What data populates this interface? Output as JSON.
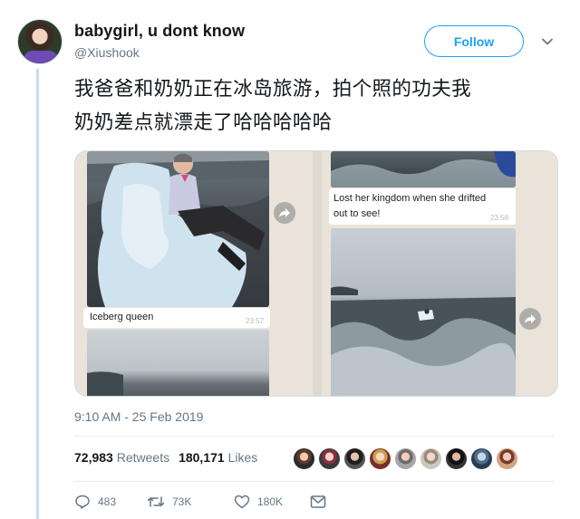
{
  "author": {
    "display_name": "babygirl, u dont know",
    "handle": "@Xiushook"
  },
  "follow_label": "Follow",
  "tweet_text_line1": "我爸爸和奶奶正在冰岛旅游，拍个照的功夫我",
  "tweet_text_line2": "奶奶差点就漂走了哈哈哈哈哈",
  "media": {
    "left_caption": "Iceberg queen",
    "left_time": "23:57",
    "right_caption_line1": "Lost her kingdom when she drifted",
    "right_caption_line2": "out to see!",
    "right_time": "23:58"
  },
  "timestamp": "9:10 AM - 25 Feb 2019",
  "stats": {
    "retweets_count": "72,983",
    "retweets_label": "Retweets",
    "likes_count": "180,171",
    "likes_label": "Likes"
  },
  "actions": {
    "replies": "483",
    "retweets": "73K",
    "likes": "180K"
  },
  "icons": [
    "chevron-down-icon",
    "share-arrow-icon",
    "reply-icon",
    "retweet-icon",
    "heart-icon",
    "direct-message-icon"
  ],
  "colors": {
    "accent": "#1da1f2",
    "muted": "#657786",
    "thread_line": "#c7dcea"
  }
}
